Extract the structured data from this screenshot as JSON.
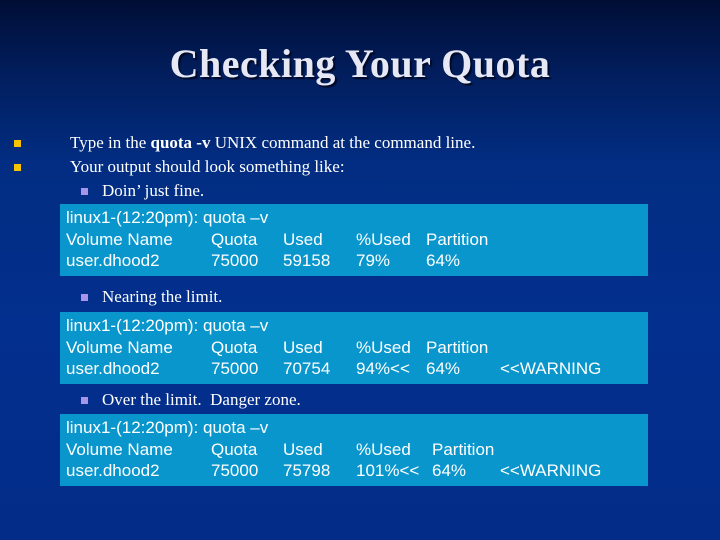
{
  "slide": {
    "title": "Checking Your Quota",
    "bullets": [
      {
        "pre": "Type in the ",
        "bold": "quota -v",
        "post": " UNIX command at the command line."
      },
      {
        "text": "Your output should look something like:"
      }
    ],
    "cases": [
      {
        "label": "Doin’ just fine.",
        "prompt": "linux1-(12:20pm): quota –v",
        "headers": [
          "Volume Name",
          "Quota",
          "Used",
          "%Used",
          "Partition"
        ],
        "row": [
          "user.dhood2",
          "75000",
          "59158",
          "79%",
          "64%"
        ],
        "warning": ""
      },
      {
        "label": "Nearing the limit.",
        "prompt": "linux1-(12:20pm): quota –v",
        "headers": [
          "Volume Name",
          "Quota",
          "Used",
          "%Used",
          "Partition"
        ],
        "row": [
          "user.dhood2",
          "75000",
          "70754",
          "94%<<",
          "64%"
        ],
        "warning": "<<WARNING"
      },
      {
        "label": "Over the limit.  Danger zone.",
        "prompt": "linux1-(12:20pm): quota –v",
        "headers": [
          "Volume Name",
          "Quota",
          "Used",
          "%Used",
          "Partition"
        ],
        "row": [
          "user.dhood2",
          "75000",
          "75798",
          "101%<<",
          "64%"
        ],
        "warning": "<<WARNING"
      }
    ]
  },
  "colors": {
    "background": "#032f8e",
    "terminal_box": "#0896cc",
    "bullet_level1": "#f5c400",
    "bullet_level2": "#a894e8"
  }
}
